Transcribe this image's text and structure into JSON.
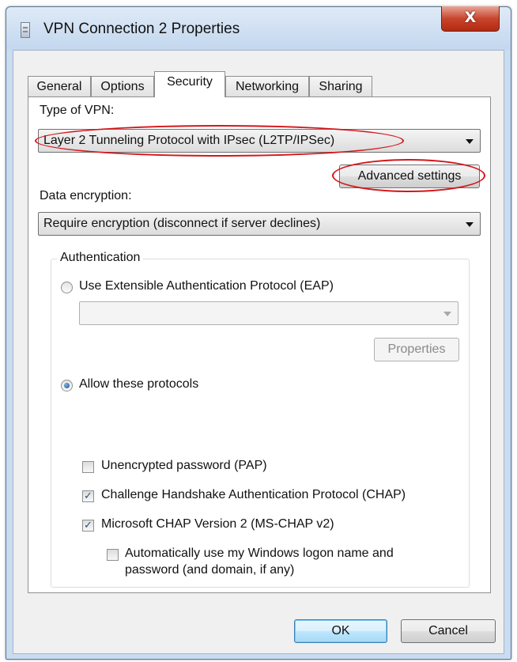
{
  "window": {
    "title": "VPN Connection 2 Properties",
    "close_glyph": "X"
  },
  "tabs": [
    {
      "label": "General"
    },
    {
      "label": "Options"
    },
    {
      "label": "Security",
      "active": true
    },
    {
      "label": "Networking"
    },
    {
      "label": "Sharing"
    }
  ],
  "security": {
    "vpn_type_label": "Type of VPN:",
    "vpn_type_value": "Layer 2 Tunneling Protocol with IPsec (L2TP/IPSec)",
    "advanced_settings_label": "Advanced settings",
    "data_encryption_label": "Data encryption:",
    "data_encryption_value": "Require encryption (disconnect if server declines)",
    "authentication": {
      "legend": "Authentication",
      "eap_label": "Use Extensible Authentication Protocol (EAP)",
      "eap_selected": false,
      "eap_combo_value": "",
      "properties_label": "Properties",
      "allow_protocols_label": "Allow these protocols",
      "allow_protocols_selected": true,
      "protocols": [
        {
          "label": "Unencrypted password (PAP)",
          "checked": false
        },
        {
          "label": "Challenge Handshake Authentication Protocol (CHAP)",
          "checked": true
        },
        {
          "label": "Microsoft CHAP Version 2 (MS-CHAP v2)",
          "checked": true
        }
      ],
      "auto_logon_line1": "Automatically use my Windows logon name and",
      "auto_logon_line2": "password (and domain, if any)",
      "auto_logon_checked": false
    }
  },
  "footer": {
    "ok_label": "OK",
    "cancel_label": "Cancel"
  },
  "colors": {
    "highlight": "#d4161b",
    "close_button": "#c8452c"
  }
}
